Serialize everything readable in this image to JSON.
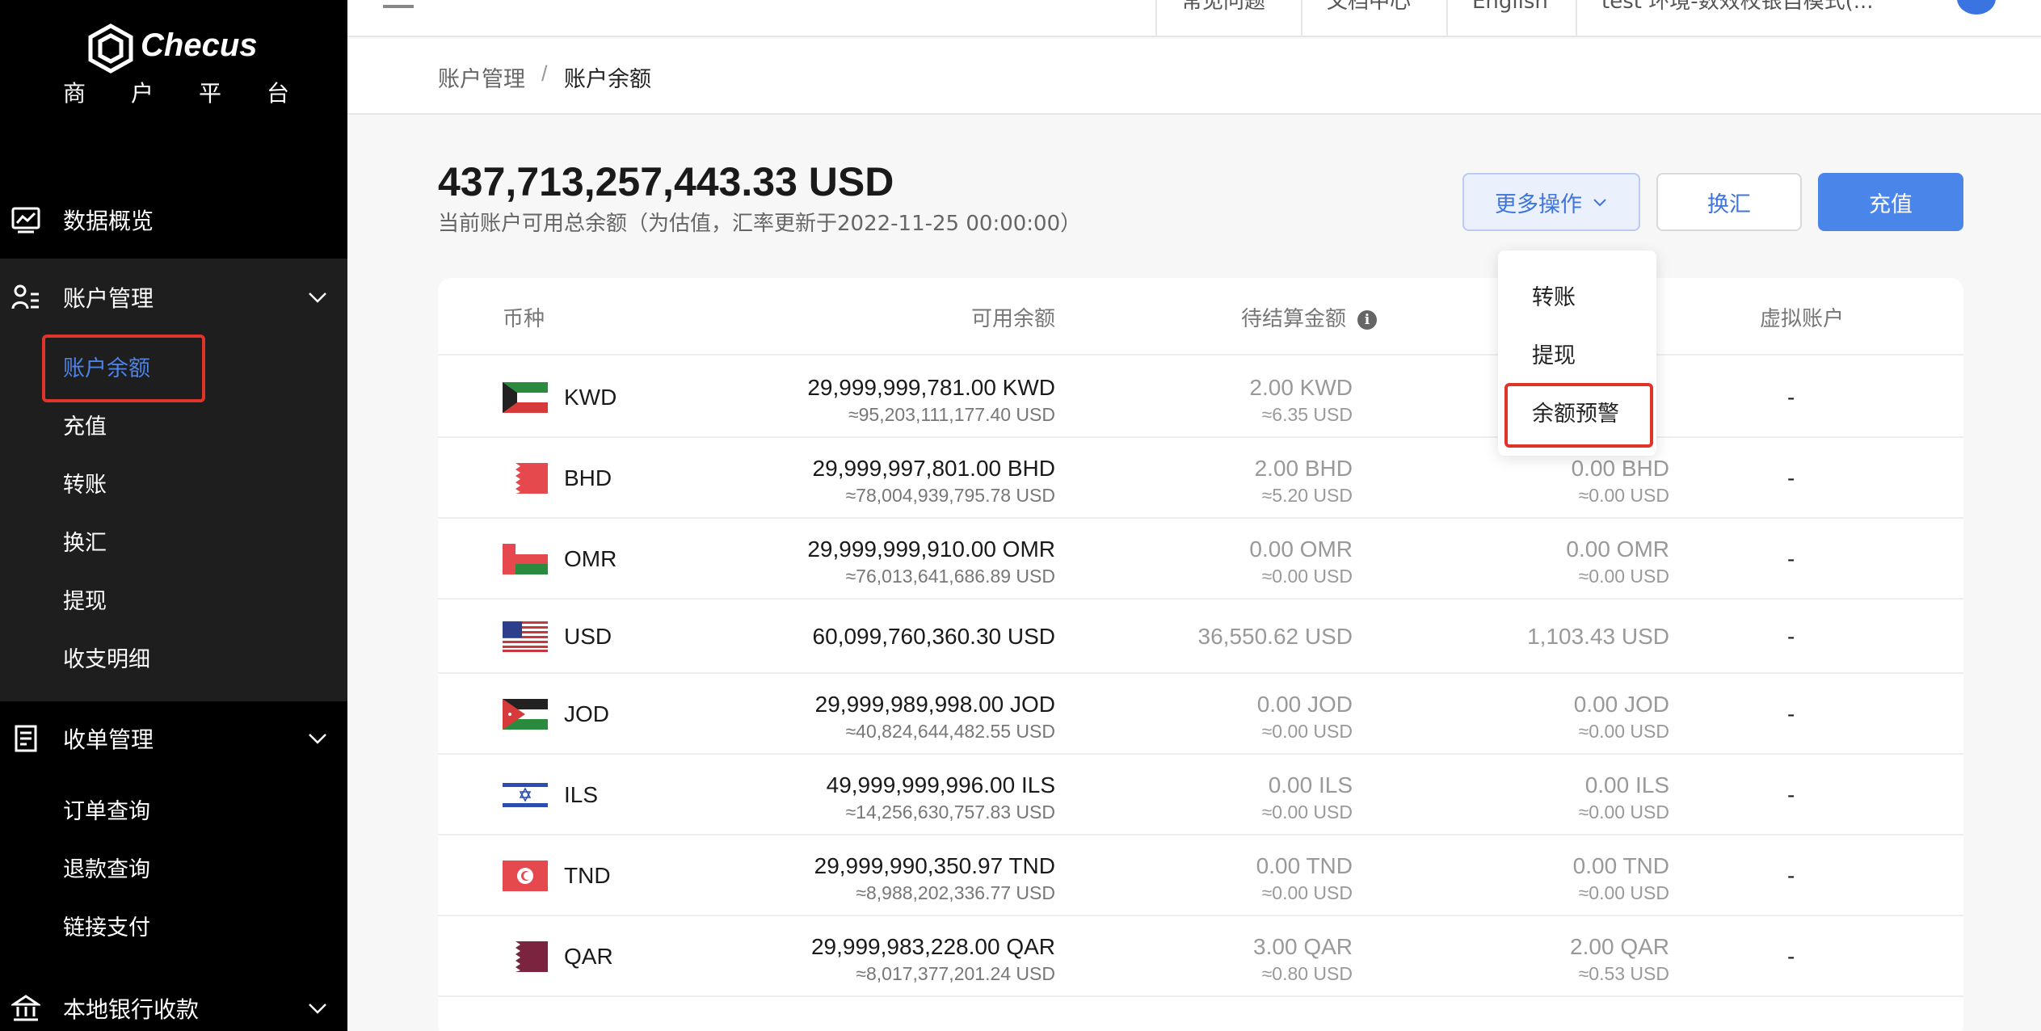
{
  "brand": {
    "name": "Checus",
    "subtitle_chars": [
      "商",
      "户",
      "平",
      "台"
    ]
  },
  "sidebar": {
    "overview": "数据概览",
    "account_mgmt": "账户管理",
    "account_items": [
      "账户余额",
      "充值",
      "转账",
      "换汇",
      "提现",
      "收支明细"
    ],
    "collection_mgmt": "收单管理",
    "collection_items": [
      "订单查询",
      "退款查询",
      "链接支付"
    ],
    "local_bank": "本地银行收款"
  },
  "topbar": {
    "links": [
      "常见问题",
      "文档中心",
      "English",
      "test 环境-数效校银自模式(..."
    ]
  },
  "breadcrumb": {
    "parent": "账户管理",
    "separator": "/",
    "current": "账户余额"
  },
  "balance": {
    "total": "437,713,257,443.33 USD",
    "description": "当前账户可用总余额（为估值，汇率更新于2022-11-25 00:00:00）"
  },
  "actions": {
    "more": "更多操作",
    "exchange": "换汇",
    "deposit": "充值"
  },
  "dropdown": {
    "items": [
      "转账",
      "提现",
      "余额预警"
    ]
  },
  "table": {
    "headers": {
      "currency": "币种",
      "available": "可用余额",
      "pending": "待结算金额",
      "virtual": "虚拟账户"
    },
    "rows": [
      {
        "code": "KWD",
        "flag": "kwd-flag",
        "available": "29,999,999,781.00 KWD",
        "available_usd": "≈95,203,111,177.40 USD",
        "pending": "2.00 KWD",
        "pending_usd": "≈6.35 USD",
        "frozen": "",
        "frozen_usd": "",
        "virtual": "-"
      },
      {
        "code": "BHD",
        "flag": "bhd-flag",
        "available": "29,999,997,801.00 BHD",
        "available_usd": "≈78,004,939,795.78 USD",
        "pending": "2.00 BHD",
        "pending_usd": "≈5.20 USD",
        "frozen": "0.00 BHD",
        "frozen_usd": "≈0.00 USD",
        "virtual": "-"
      },
      {
        "code": "OMR",
        "flag": "omr-flag",
        "available": "29,999,999,910.00 OMR",
        "available_usd": "≈76,013,641,686.89 USD",
        "pending": "0.00 OMR",
        "pending_usd": "≈0.00 USD",
        "frozen": "0.00 OMR",
        "frozen_usd": "≈0.00 USD",
        "virtual": "-"
      },
      {
        "code": "USD",
        "flag": "usd-flag",
        "available": "60,099,760,360.30 USD",
        "available_usd": "",
        "pending": "36,550.62 USD",
        "pending_usd": "",
        "frozen": "1,103.43 USD",
        "frozen_usd": "",
        "virtual": "-"
      },
      {
        "code": "JOD",
        "flag": "jod-flag",
        "available": "29,999,989,998.00 JOD",
        "available_usd": "≈40,824,644,482.55 USD",
        "pending": "0.00 JOD",
        "pending_usd": "≈0.00 USD",
        "frozen": "0.00 JOD",
        "frozen_usd": "≈0.00 USD",
        "virtual": "-"
      },
      {
        "code": "ILS",
        "flag": "ils-flag",
        "available": "49,999,999,996.00 ILS",
        "available_usd": "≈14,256,630,757.83 USD",
        "pending": "0.00 ILS",
        "pending_usd": "≈0.00 USD",
        "frozen": "0.00 ILS",
        "frozen_usd": "≈0.00 USD",
        "virtual": "-"
      },
      {
        "code": "TND",
        "flag": "tnd-flag",
        "available": "29,999,990,350.97 TND",
        "available_usd": "≈8,988,202,336.77 USD",
        "pending": "0.00 TND",
        "pending_usd": "≈0.00 USD",
        "frozen": "0.00 TND",
        "frozen_usd": "≈0.00 USD",
        "virtual": "-"
      },
      {
        "code": "QAR",
        "flag": "qar-flag",
        "available": "29,999,983,228.00 QAR",
        "available_usd": "≈8,017,377,201.24 USD",
        "pending": "3.00 QAR",
        "pending_usd": "≈0.80 USD",
        "frozen": "2.00 QAR",
        "frozen_usd": "≈0.53 USD",
        "virtual": "-"
      }
    ]
  },
  "colors": {
    "primary": "#4a85ea",
    "highlight": "#e0342a",
    "sidebar_bg": "#000000"
  }
}
